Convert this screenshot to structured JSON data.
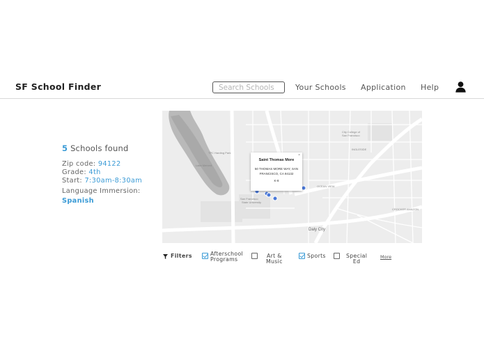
{
  "header": {
    "brand": "SF School Finder",
    "search_placeholder": "Search Schools",
    "nav": {
      "your_schools": "Your Schools",
      "application": "Application",
      "help": "Help"
    },
    "user_icon": "user-icon"
  },
  "results": {
    "count": "5",
    "found_label": "Schools found",
    "zip_label": "Zip code:",
    "zip_value": "94122",
    "grade_label": "Grade:",
    "grade_value": "4th",
    "start_label": "Start:",
    "start_value": "7:30am-8:30am",
    "language_label": "Language Immersion:",
    "language_value": "Spanish"
  },
  "map": {
    "popup": {
      "close": "×",
      "name": "Saint Thomas More",
      "address_line1": "50 THOMAS MORE WAY, SAN",
      "address_line2": "FRANCISCO, CA 94132",
      "grade": "K-8"
    },
    "labels": {
      "daly_city": "Daly City",
      "oceanview": "OCEAN VIEW",
      "ingleside": "INGLESIDE",
      "crocker": "CROCKER AMAZON",
      "lake": "Lake Merced",
      "city_college": "City College of San Francisco"
    },
    "pin_color": "#4a78d8"
  },
  "filters": {
    "label": "Filters",
    "afterschool": {
      "line1": "Afterschool",
      "line2": "Programs",
      "checked": true
    },
    "art_music": {
      "line1": "Art &",
      "line2": "Music",
      "checked": false
    },
    "sports": {
      "line1": "Sports",
      "checked": true
    },
    "special_ed": {
      "line1": "Special",
      "line2": "Ed",
      "checked": false
    },
    "more": "More"
  },
  "colors": {
    "accent": "#3b9bd6"
  }
}
